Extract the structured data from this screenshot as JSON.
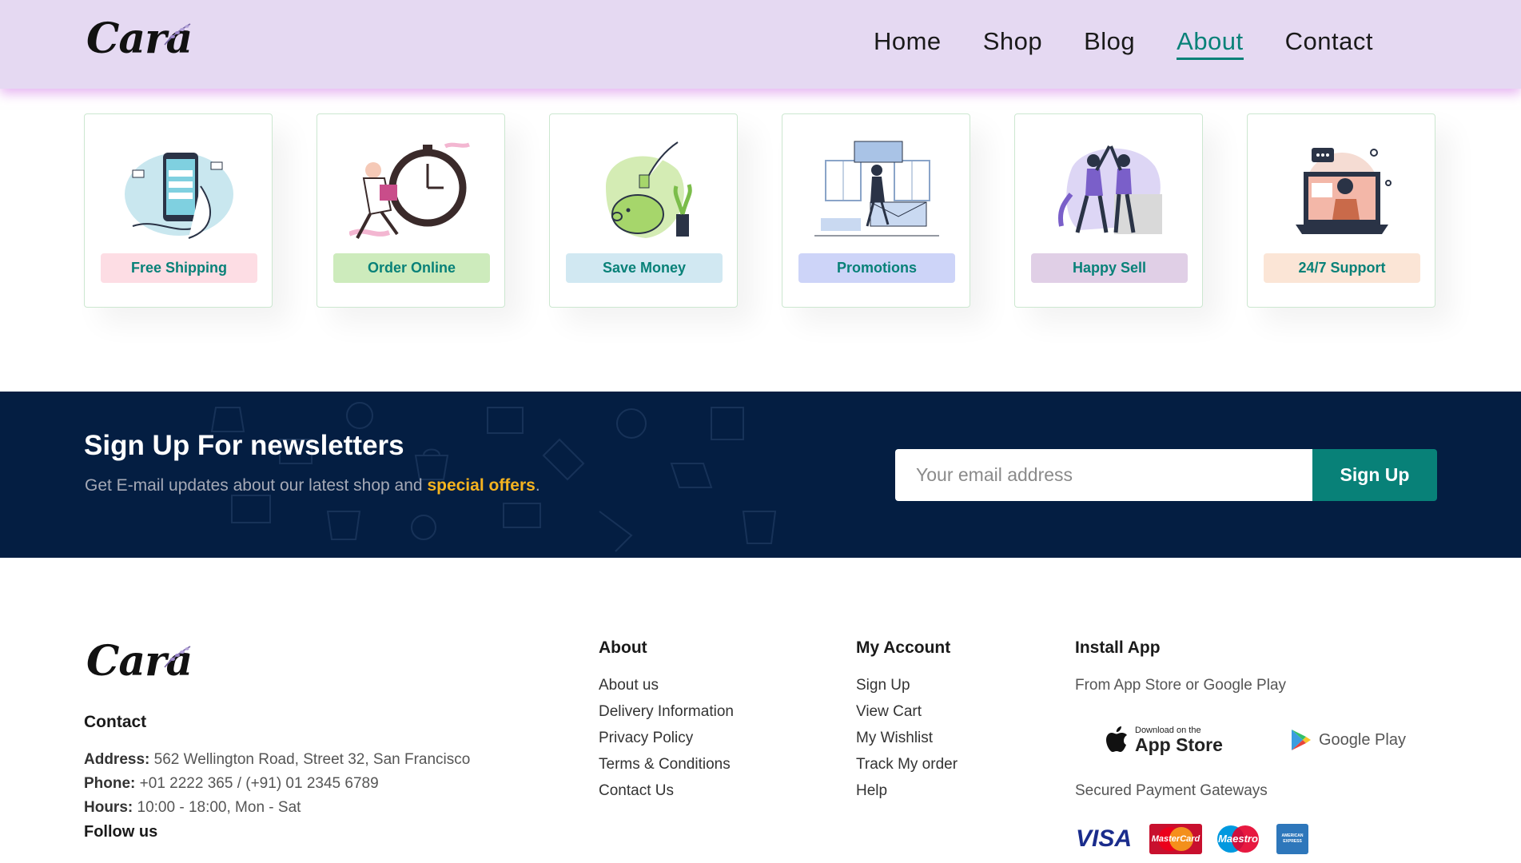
{
  "brand": {
    "name": "Cara"
  },
  "nav": {
    "items": [
      {
        "label": "Home",
        "active": false
      },
      {
        "label": "Shop",
        "active": false
      },
      {
        "label": "Blog",
        "active": false
      },
      {
        "label": "About",
        "active": true
      },
      {
        "label": "Contact",
        "active": false
      }
    ]
  },
  "features": [
    {
      "label": "Free Shipping",
      "bg": "#fddde4",
      "icon": "payment-phone-illustration"
    },
    {
      "label": "Order Online",
      "bg": "#cdebbc",
      "icon": "delivery-clock-illustration"
    },
    {
      "label": "Save Money",
      "bg": "#d1e8f2",
      "icon": "piggy-bank-illustration"
    },
    {
      "label": "Promotions",
      "bg": "#cdd4f8",
      "icon": "promotions-illustration"
    },
    {
      "label": "Happy Sell",
      "bg": "#e0cfe6",
      "icon": "high-five-illustration"
    },
    {
      "label": "24/7 Support",
      "bg": "#f6dbf6",
      "icon": "support-laptop-illustration"
    }
  ],
  "newsletter": {
    "title": "Sign Up For newsletters",
    "subtitle": "Get E-mail updates about our latest shop and ",
    "highlight": "special offers",
    "suffix": ".",
    "placeholder": "Your email address",
    "button": "Sign Up"
  },
  "footer": {
    "contact": {
      "heading": "Contact",
      "address_label": "Address:",
      "address": " 562 Wellington Road, Street 32, San Francisco",
      "phone_label": "Phone:",
      "phone": " +01 2222 365 / (+91) 01 2345 6789",
      "hours_label": "Hours:",
      "hours": " 10:00 - 18:00, Mon - Sat",
      "follow": "Follow us"
    },
    "about": {
      "heading": "About",
      "links": [
        "About us",
        "Delivery Information",
        "Privacy Policy",
        "Terms & Conditions",
        "Contact Us"
      ]
    },
    "account": {
      "heading": "My Account",
      "links": [
        "Sign Up",
        "View Cart",
        "My Wishlist",
        "Track My order",
        "Help"
      ]
    },
    "install": {
      "heading": "Install App",
      "text": "From App Store or Google Play",
      "appstore_small": "Download on the",
      "appstore_big": "App Store",
      "googleplay": "Google Play",
      "payments_text": "Secured Payment Gateways",
      "payments": [
        "VISA",
        "MasterCard",
        "Maestro",
        "AMERICAN EXPRESS"
      ]
    }
  },
  "colors": {
    "accent": "#088178",
    "header_bg": "#e5d9f2",
    "newsletter_bg": "#041e42",
    "highlight": "#f5b31f"
  }
}
